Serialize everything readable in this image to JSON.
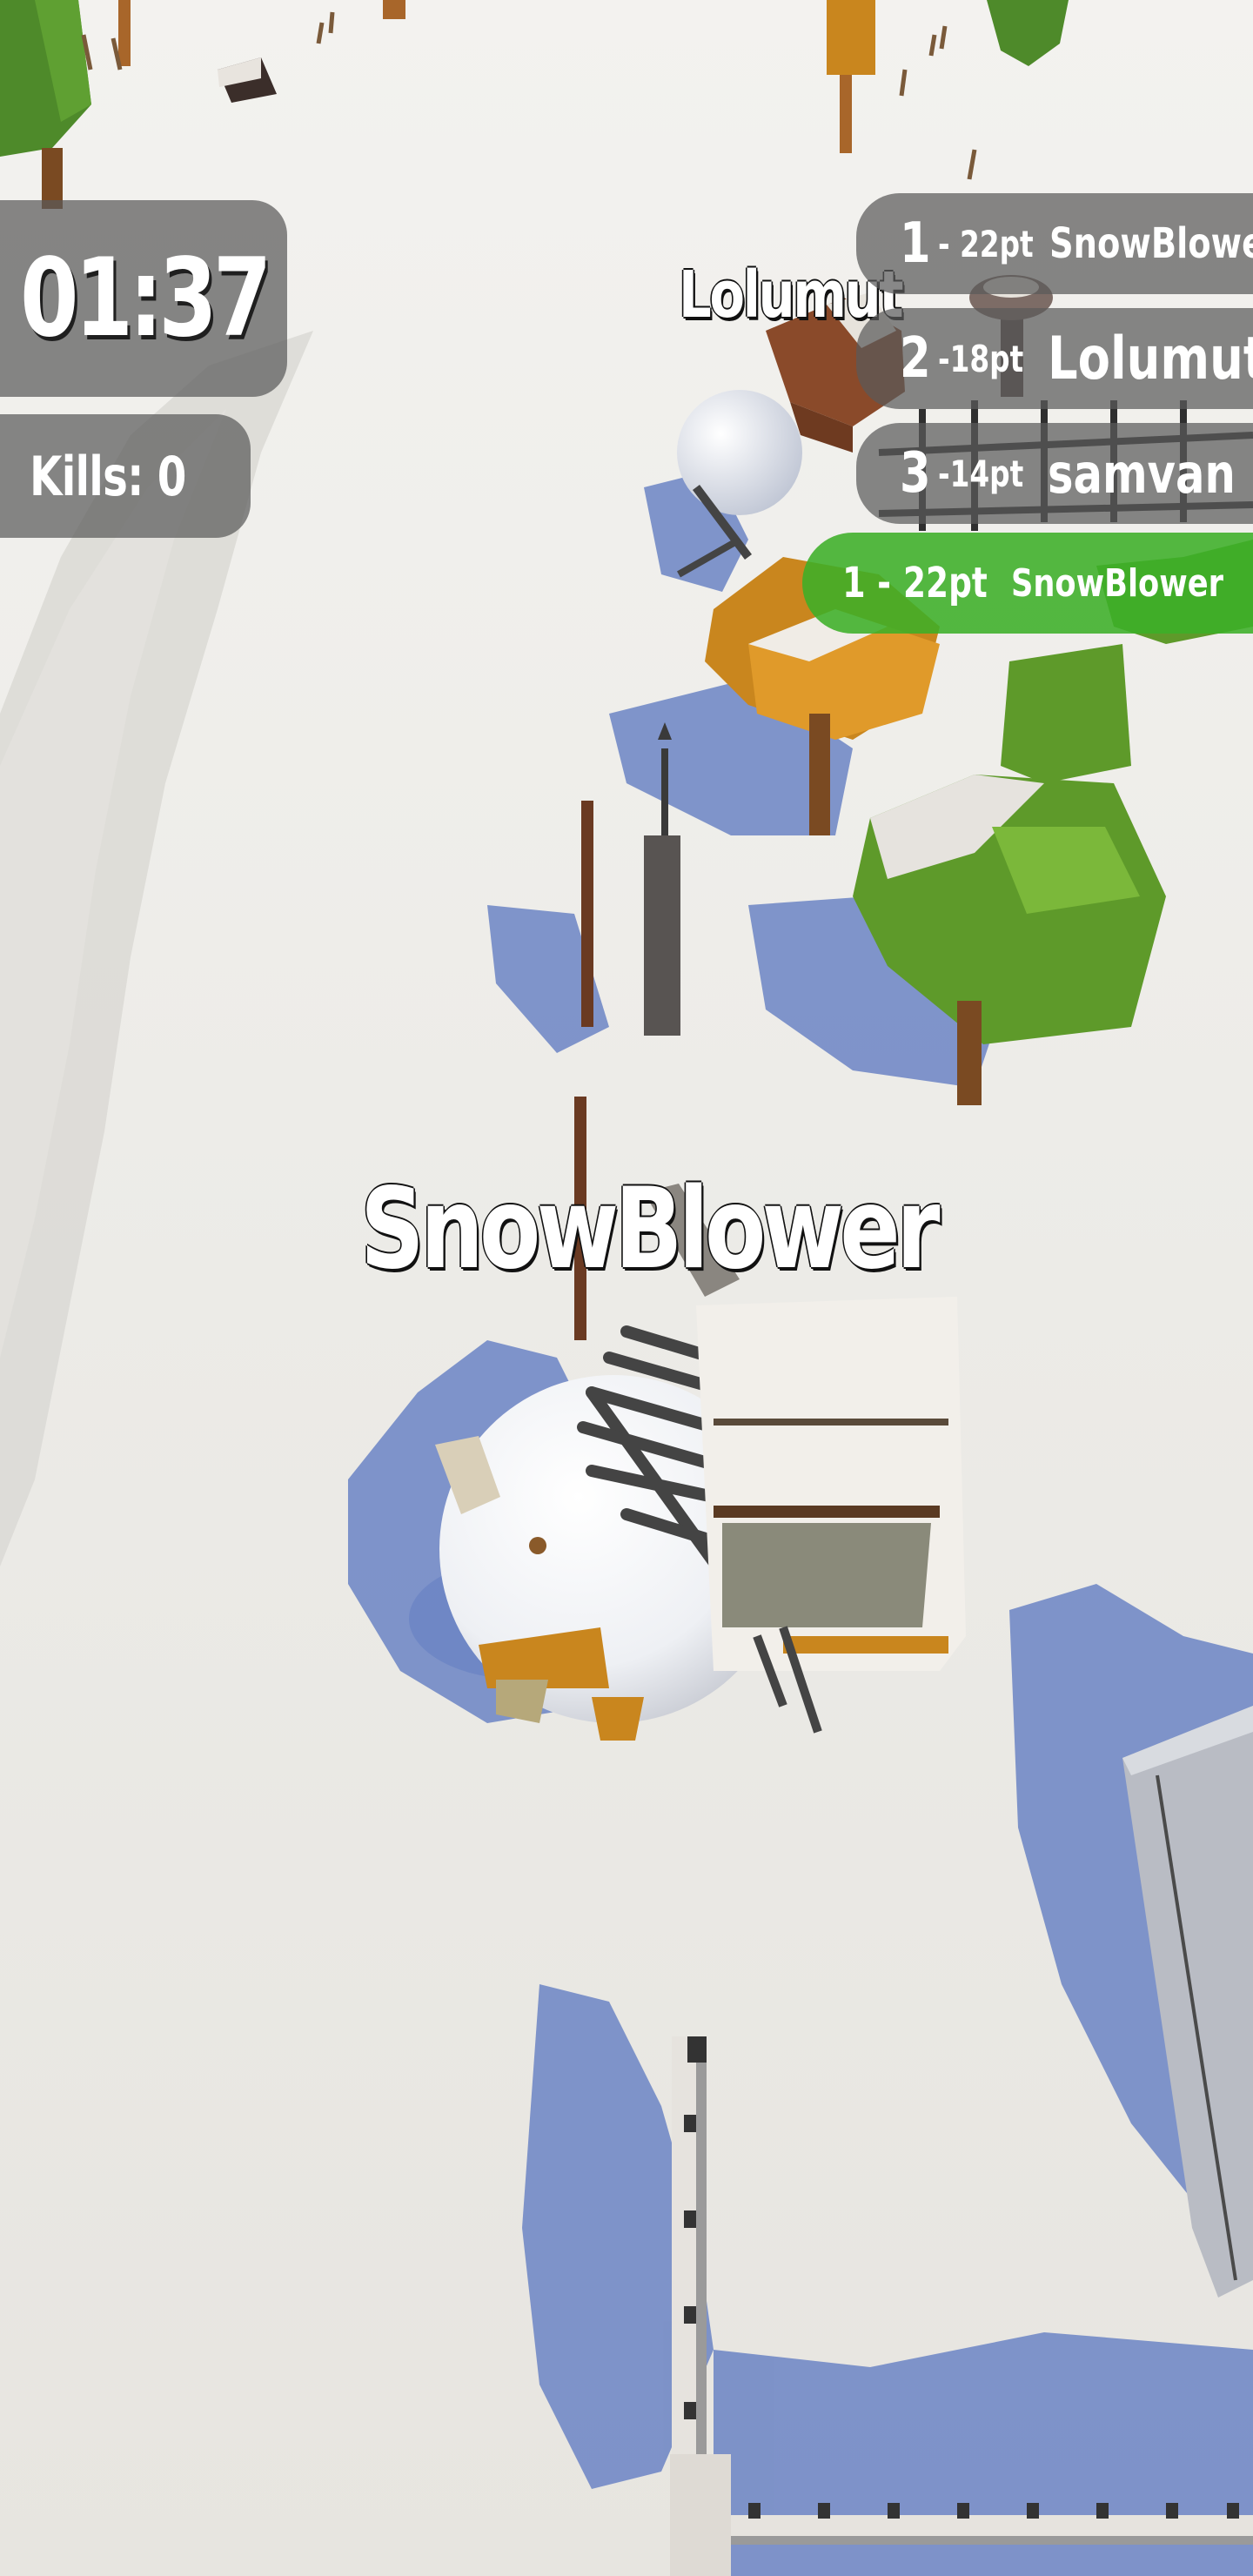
{
  "hud": {
    "timer": "01:37",
    "kills": "Kills: 0"
  },
  "leaderboard": [
    {
      "rank": "1",
      "points": "- 22pt",
      "name": "SnowBlower"
    },
    {
      "rank": "2",
      "points": "-18pt",
      "name": "Lolumut"
    },
    {
      "rank": "3",
      "points": "-14pt",
      "name": "samvan"
    }
  ],
  "player_rank": {
    "rank": "1 -",
    "points": "22pt",
    "name": "SnowBlower"
  },
  "nametags": {
    "main_player": "SnowBlower",
    "other_player": "Lolumut"
  },
  "colors": {
    "snow": "#eeece8",
    "shadow": "#6b84c4",
    "hud_panel": "#5a5a5a",
    "player_highlight": "#3caf28",
    "tree_green": "#5e9a2a",
    "wood_orange": "#c9861e"
  }
}
